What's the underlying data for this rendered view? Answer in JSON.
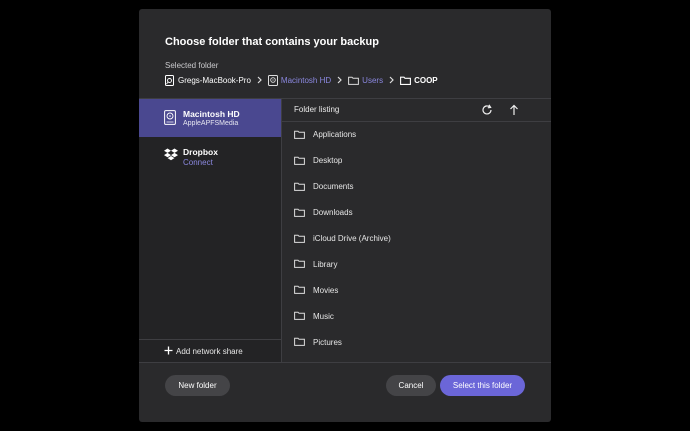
{
  "dialog": {
    "title": "Choose folder that contains your backup",
    "selected_folder_label": "Selected folder",
    "breadcrumb": [
      {
        "label": "Gregs-MacBook-Pro",
        "icon": "computer-icon",
        "style": "normal"
      },
      {
        "label": "Macintosh HD",
        "icon": "disk-icon",
        "style": "link"
      },
      {
        "label": "Users",
        "icon": "folder-icon",
        "style": "link"
      },
      {
        "label": "COOP",
        "icon": "folder-icon",
        "style": "bold"
      }
    ]
  },
  "sidebar": {
    "drives": [
      {
        "name": "Macintosh HD",
        "subtitle": "AppleAPFSMedia",
        "icon": "hard-disk-icon",
        "selected": true
      },
      {
        "name": "Dropbox",
        "subtitle": "Connect",
        "icon": "dropbox-icon",
        "selected": false
      }
    ],
    "add_network_share": "Add network share"
  },
  "listing": {
    "header": "Folder listing",
    "folders": [
      "Applications",
      "Desktop",
      "Documents",
      "Downloads",
      "iCloud Drive (Archive)",
      "Library",
      "Movies",
      "Music",
      "Pictures"
    ]
  },
  "footer": {
    "new_folder": "New folder",
    "cancel": "Cancel",
    "select": "Select this folder"
  },
  "colors": {
    "accent": "#6b66d8",
    "selected_bg": "#4a4890",
    "link": "#8b88e0",
    "dialog_bg": "#2a2a2c"
  }
}
